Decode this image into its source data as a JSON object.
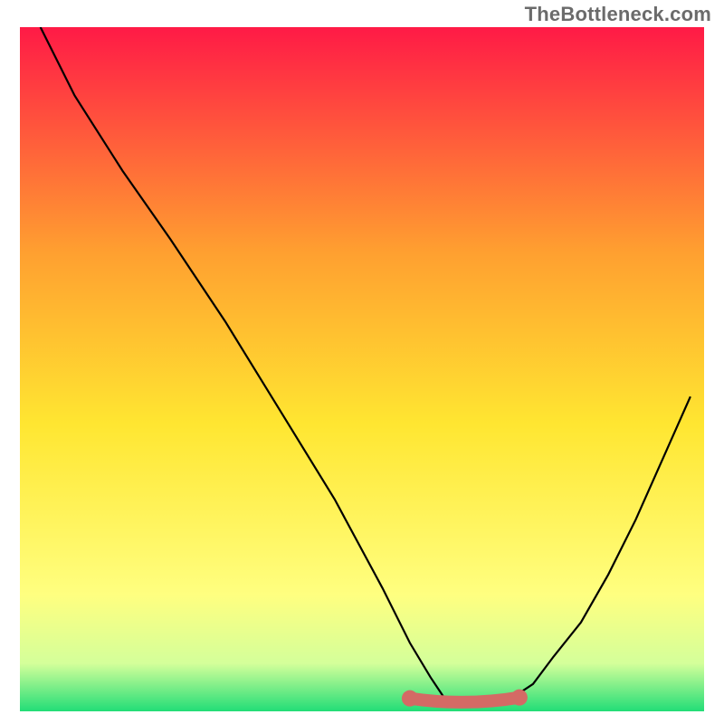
{
  "watermark": "TheBottleneck.com",
  "colors": {
    "gradient_top": "#ff1a46",
    "gradient_mid_upper": "#ffa030",
    "gradient_mid": "#ffe631",
    "gradient_lower": "#ffff80",
    "gradient_bottom_light": "#d4ff9a",
    "gradient_bottom": "#22dd77",
    "curve": "#000000",
    "marker": "#d46a65"
  },
  "chart_data": {
    "type": "line",
    "title": "",
    "xlabel": "",
    "ylabel": "",
    "xlim": [
      0,
      100
    ],
    "ylim": [
      0,
      100
    ],
    "series": [
      {
        "name": "bottleneck-curve",
        "x": [
          3,
          8,
          15,
          22,
          30,
          38,
          46,
          53,
          57,
          60,
          62,
          64,
          67,
          70,
          72,
          75,
          78,
          82,
          86,
          90,
          94,
          98
        ],
        "y": [
          100,
          90,
          79,
          69,
          57,
          44,
          31,
          18,
          10,
          5,
          2,
          1,
          1,
          1,
          2,
          4,
          8,
          13,
          20,
          28,
          37,
          46
        ]
      }
    ],
    "markers": {
      "name": "optimal-range-highlight",
      "x_start": 57,
      "x_end": 73,
      "y": 1.5
    }
  }
}
